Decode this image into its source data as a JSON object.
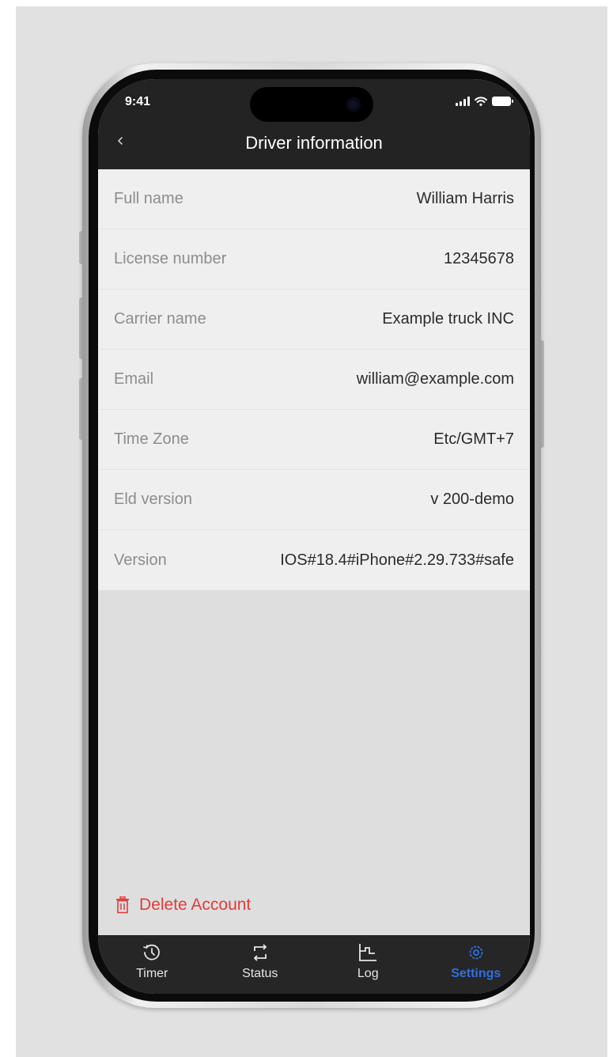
{
  "status_bar": {
    "time": "9:41"
  },
  "header": {
    "title": "Driver information",
    "back_icon": "chevron-left-icon"
  },
  "info": [
    {
      "label": "Full name",
      "value": "William Harris"
    },
    {
      "label": "License number",
      "value": "12345678"
    },
    {
      "label": "Carrier name",
      "value": "Example truck INC"
    },
    {
      "label": "Email",
      "value": "william@example.com"
    },
    {
      "label": "Time Zone",
      "value": "Etc/GMT+7"
    },
    {
      "label": "Eld version",
      "value": "v 200-demo"
    },
    {
      "label": "Version",
      "value": "IOS#18.4#iPhone#2.29.733#safe"
    }
  ],
  "delete_account": {
    "label": "Delete Account",
    "icon": "trash-icon"
  },
  "tabs": [
    {
      "label": "Timer",
      "icon": "timer-icon",
      "active": false
    },
    {
      "label": "Status",
      "icon": "switch-icon",
      "active": false
    },
    {
      "label": "Log",
      "icon": "log-chart-icon",
      "active": false
    },
    {
      "label": "Settings",
      "icon": "gear-icon",
      "active": true
    }
  ],
  "colors": {
    "header_bg": "#232323",
    "list_bg": "#efefef",
    "screen_bg": "#dedede",
    "danger": "#e33b3b",
    "accent": "#2f6fe4",
    "tabbar_bg": "#262626"
  }
}
